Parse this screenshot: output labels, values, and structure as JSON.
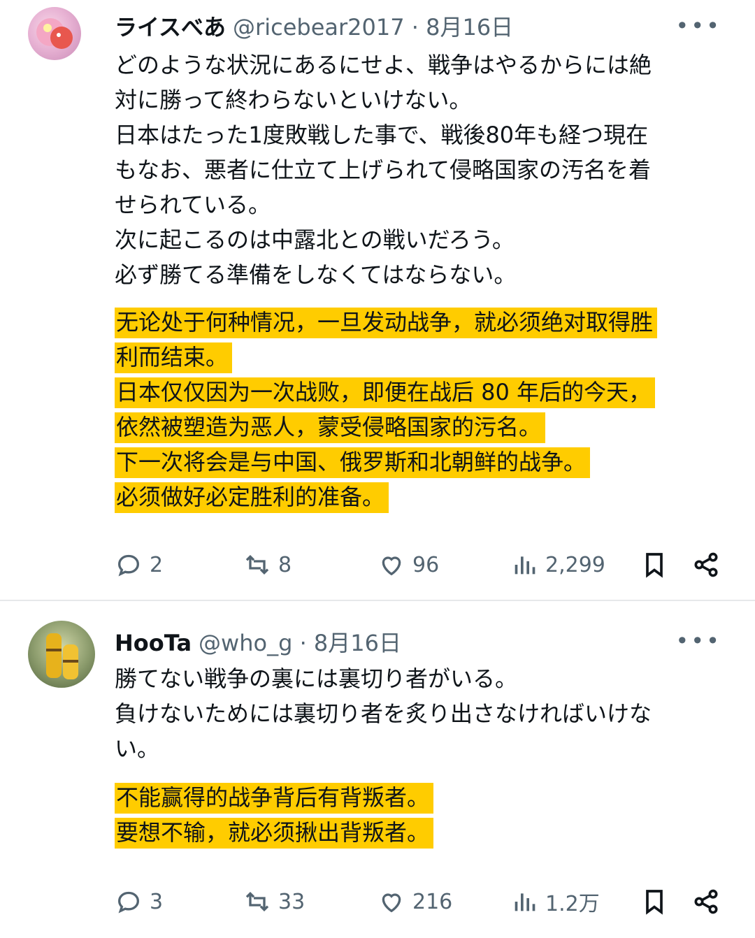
{
  "posts": [
    {
      "display_name": "ライスべあ",
      "handle": "@ricebear2017",
      "date": "8月16日",
      "more": "•••",
      "jp_lines": [
        "どのような状況にあるにせよ、戦争はやるからには絶",
        "対に勝って終わらないといけない。",
        "日本はたった1度敗戦した事で、戦後80年も経つ現在",
        "もなお、悪者に仕立て上げられて侵略国家の汚名を着",
        "せられている。",
        "次に起こるのは中露北との戦いだろう。",
        "必ず勝てる準備をしなくてはならない。"
      ],
      "zh_lines": [
        "无论处于何种情况，一旦发动战争，就必须绝对取得胜",
        "利而结束。",
        "日本仅仅因为一次战败，即便在战后 80 年后的今天，",
        "依然被塑造为恶人，蒙受侵略国家的污名。",
        "下一次将会是与中国、俄罗斯和北朝鲜的战争。",
        "必须做好必定胜利的准备。"
      ],
      "replies": "2",
      "reposts": "8",
      "likes": "96",
      "views": "2,299"
    },
    {
      "display_name": "HooTa",
      "handle": "@who_g",
      "date": "8月16日",
      "more": "•••",
      "jp_lines": [
        "勝てない戦争の裏には裏切り者がいる。",
        "負けないためには裏切り者を炙り出さなければいけな",
        "い。"
      ],
      "zh_lines": [
        "不能赢得的战争背后有背叛者。",
        "要想不输，就必须揪出背叛者。"
      ],
      "replies": "3",
      "reposts": "33",
      "likes": "216",
      "views": "1.2万"
    }
  ],
  "icons": {
    "reply": "reply-icon",
    "repost": "repost-icon",
    "like": "heart-icon",
    "views": "views-icon",
    "bookmark": "bookmark-icon",
    "share": "share-icon"
  },
  "colors": {
    "highlight": "#ffcc00",
    "secondary_text": "#536471",
    "primary_text": "#0f1419"
  }
}
